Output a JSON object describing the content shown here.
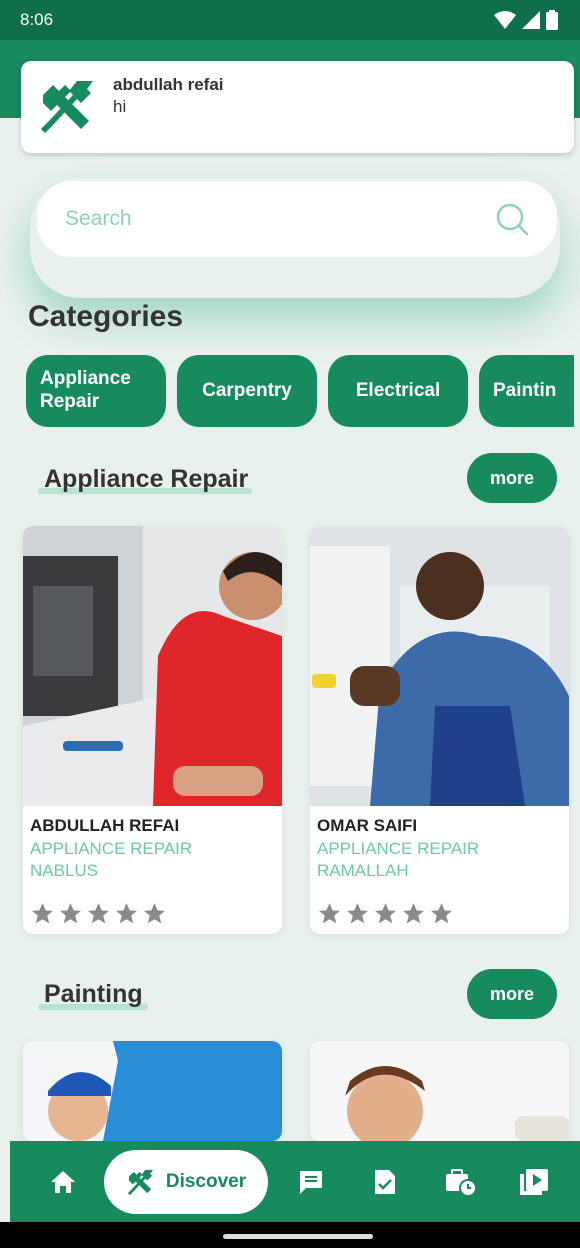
{
  "status_bar": {
    "time": "8:06"
  },
  "notification": {
    "title": "abdullah refai",
    "body": "hi"
  },
  "search": {
    "placeholder": "Search"
  },
  "categories_title": "Categories",
  "chips": [
    "Appliance Repair",
    "Carpentry",
    "Electrical",
    "Paintin"
  ],
  "sections": [
    {
      "title": "Appliance Repair",
      "more": "more",
      "cards": [
        {
          "name": "ABDULLAH REFAI",
          "category": "APPLIANCE REPAIR",
          "city": "NABLUS",
          "rating": 0
        },
        {
          "name": "OMAR SAIFI",
          "category": "APPLIANCE REPAIR",
          "city": "RAMALLAH",
          "rating": 0
        }
      ]
    },
    {
      "title": "Painting",
      "more": "more"
    }
  ],
  "bottom_nav": {
    "active_label": "Discover"
  },
  "colors": {
    "primary": "#178a5e",
    "status": "#0f6f4a",
    "accent_text": "#6fc7a2",
    "star": "#8a8a8a"
  }
}
